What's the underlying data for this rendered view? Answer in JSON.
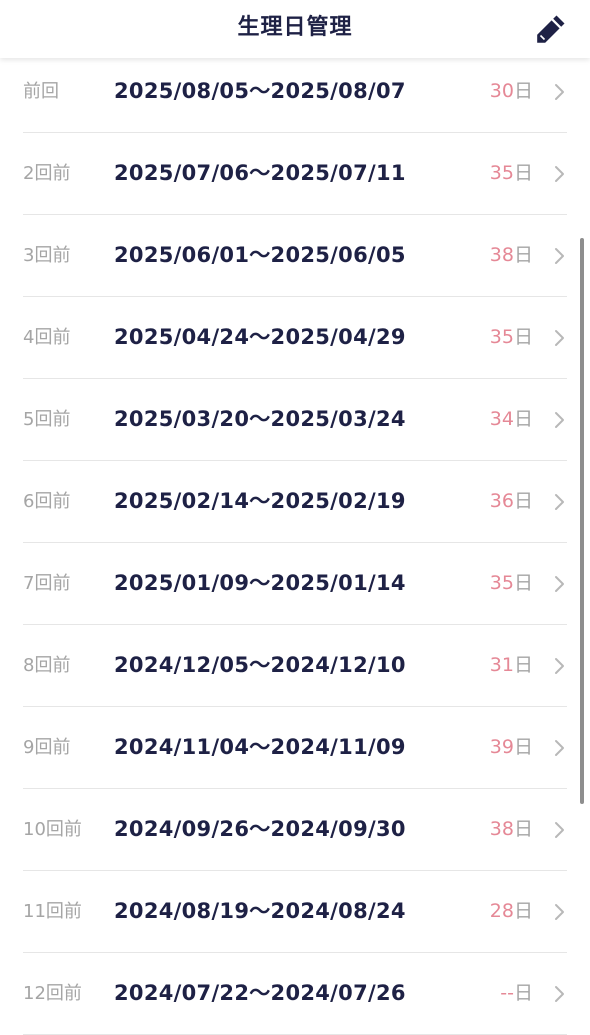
{
  "header": {
    "title": "生理日管理",
    "edit_icon": "pencil-icon"
  },
  "colors": {
    "text_dark": "#1e2145",
    "label_gray": "#a5a5a5",
    "accent_pink": "#e58896",
    "divider": "#e6e6e6"
  },
  "records": [
    {
      "label": "前回",
      "dates": "2025/08/05〜2025/08/07",
      "days": "30",
      "unit": "日"
    },
    {
      "label": "2回前",
      "dates": "2025/07/06〜2025/07/11",
      "days": "35",
      "unit": "日"
    },
    {
      "label": "3回前",
      "dates": "2025/06/01〜2025/06/05",
      "days": "38",
      "unit": "日"
    },
    {
      "label": "4回前",
      "dates": "2025/04/24〜2025/04/29",
      "days": "35",
      "unit": "日"
    },
    {
      "label": "5回前",
      "dates": "2025/03/20〜2025/03/24",
      "days": "34",
      "unit": "日"
    },
    {
      "label": "6回前",
      "dates": "2025/02/14〜2025/02/19",
      "days": "36",
      "unit": "日"
    },
    {
      "label": "7回前",
      "dates": "2025/01/09〜2025/01/14",
      "days": "35",
      "unit": "日"
    },
    {
      "label": "8回前",
      "dates": "2024/12/05〜2024/12/10",
      "days": "31",
      "unit": "日"
    },
    {
      "label": "9回前",
      "dates": "2024/11/04〜2024/11/09",
      "days": "39",
      "unit": "日"
    },
    {
      "label": "10回前",
      "dates": "2024/09/26〜2024/09/30",
      "days": "38",
      "unit": "日"
    },
    {
      "label": "11回前",
      "dates": "2024/08/19〜2024/08/24",
      "days": "28",
      "unit": "日"
    },
    {
      "label": "12回前",
      "dates": "2024/07/22〜2024/07/26",
      "days": "--",
      "unit": "日"
    }
  ]
}
